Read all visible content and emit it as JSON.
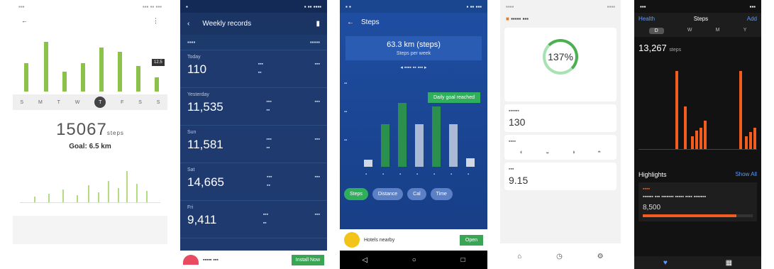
{
  "p1": {
    "step_value": "15067",
    "step_unit": "steps",
    "subtitle": "Goal: 6.5 km",
    "day_selected": "T",
    "days": [
      "S",
      "M",
      "T",
      "W",
      "T",
      "F",
      "S",
      "S"
    ],
    "tooltip": "12.5"
  },
  "p2": {
    "title": "Weekly records",
    "rows": [
      {
        "value": "110",
        "date": "Today"
      },
      {
        "value": "11,535",
        "date": "Yesterday"
      },
      {
        "value": "11,581",
        "date": "Sun"
      },
      {
        "value": "14,665",
        "date": "Sat"
      },
      {
        "value": "9,411",
        "date": "Fri"
      }
    ],
    "ad_button": "Install Now"
  },
  "p3": {
    "title": "Steps",
    "card_title": "63.3 km (steps)",
    "card_sub": "Steps per week",
    "goal_label": "Daily goal reached",
    "pills": [
      "Steps",
      "Distance",
      "Cal",
      "Time"
    ],
    "ad_title": "Hotels nearby",
    "ad_button": "Open",
    "nav_icons": [
      "◁",
      "○",
      "□"
    ]
  },
  "p4": {
    "ring_value": "137%",
    "card1_value": "130",
    "card3_value": "9.15",
    "nav_icons": [
      "⌂",
      "◷",
      "⚙"
    ]
  },
  "p5": {
    "nav_left": "Health",
    "title": "Steps",
    "nav_right": "Add",
    "segments": [
      "D",
      "W",
      "M",
      "Y"
    ],
    "value": "13,267",
    "value_unit": "steps",
    "highlights": "Highlights",
    "show_all": "Show All",
    "card_value": "8,500",
    "progress": 0.85,
    "tab_icons": [
      "♥",
      "▦"
    ]
  }
}
